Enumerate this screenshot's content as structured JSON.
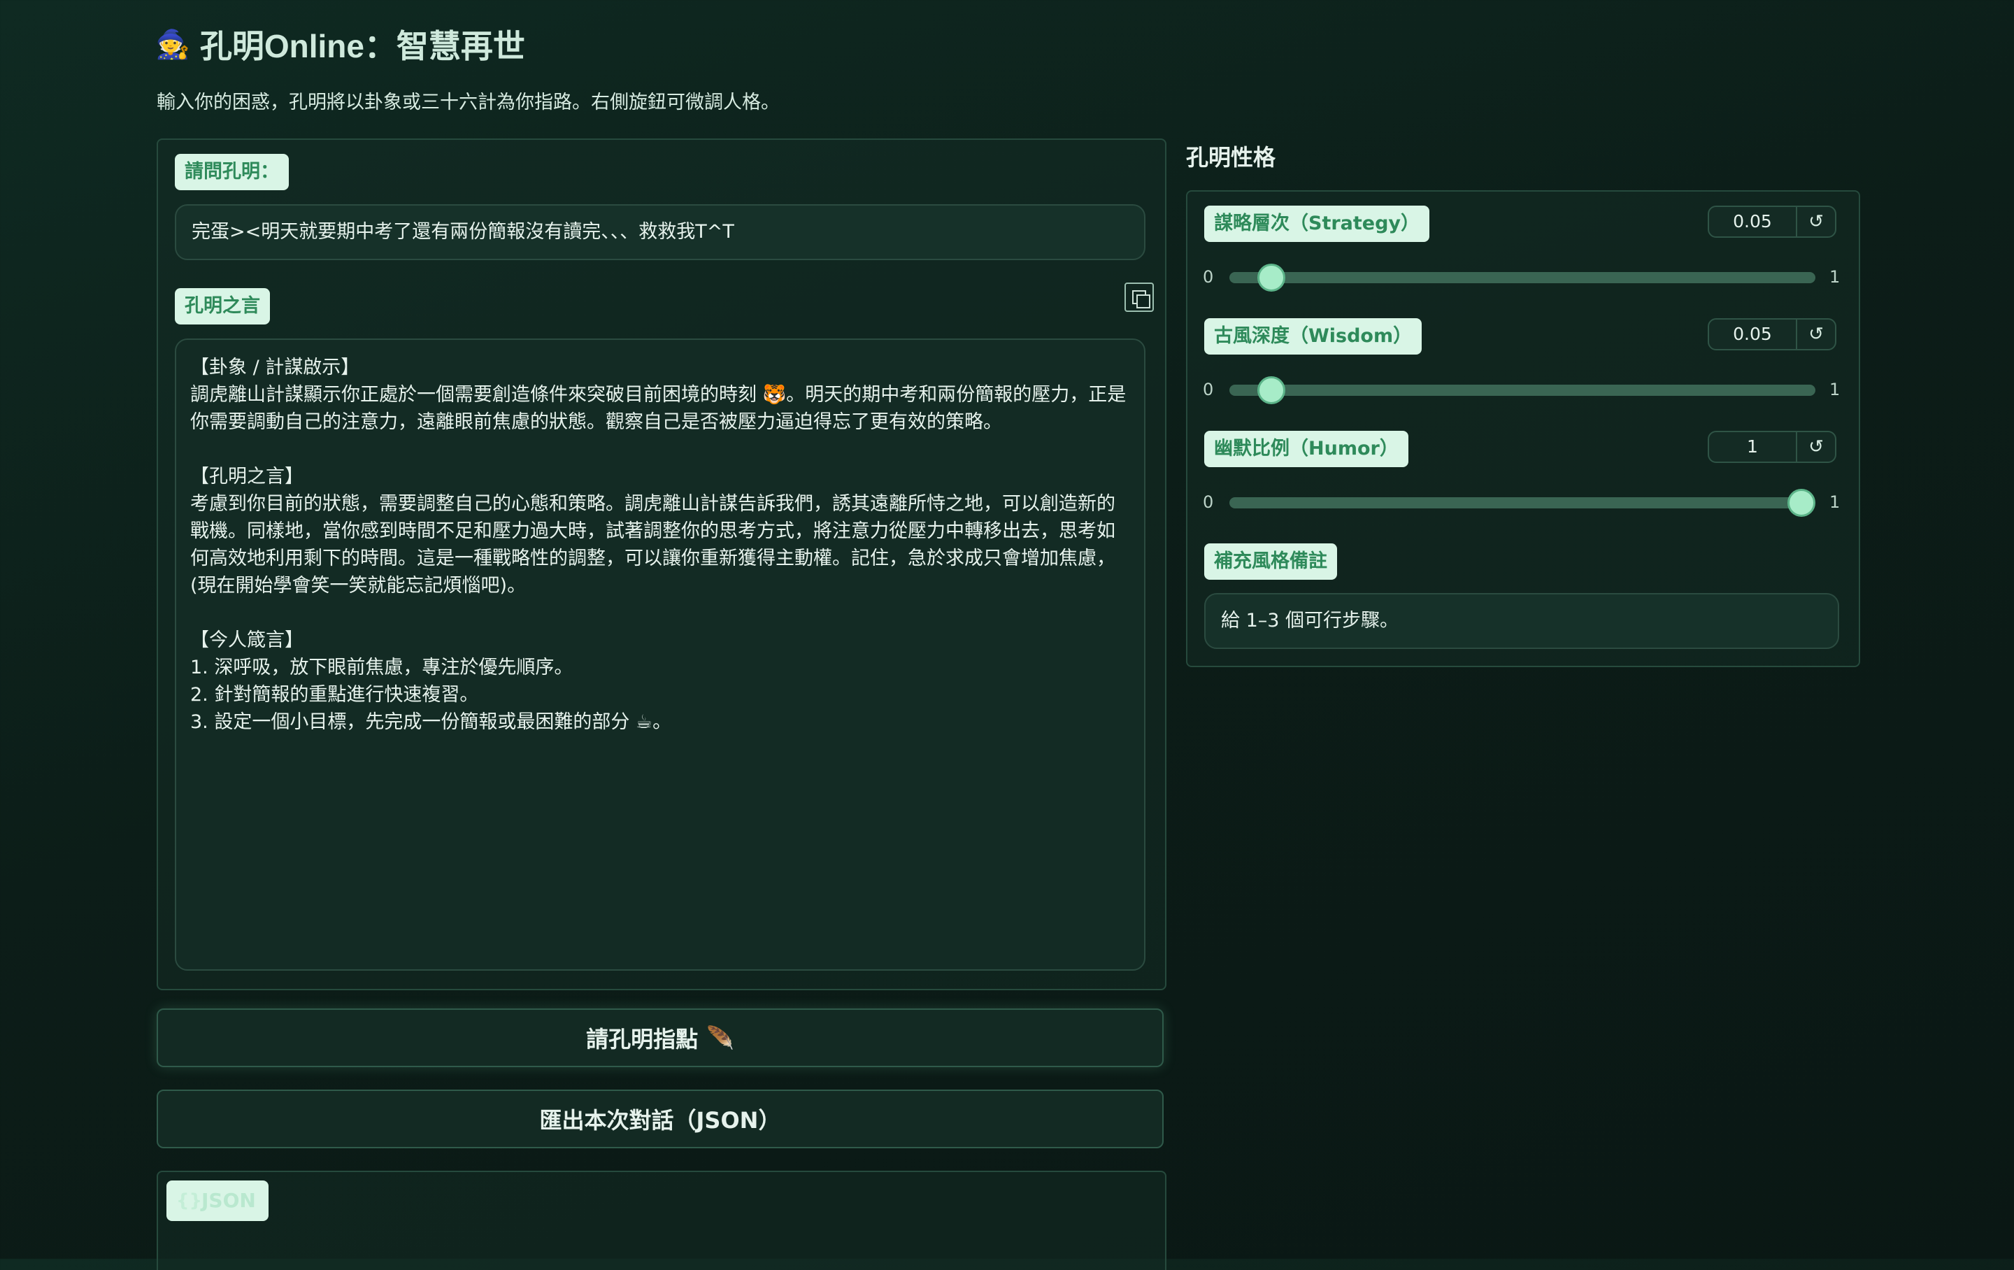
{
  "header": {
    "title_emoji": "🧙",
    "title": "孔明Online：智慧再世",
    "subtitle": "輸入你的困惑，孔明將以卦象或三十六計為你指路。右側旋鈕可微調人格。"
  },
  "question": {
    "label": "請問孔明：",
    "value": "完蛋><明天就要期中考了還有兩份簡報沒有讀完、、、救救我T^T"
  },
  "answer": {
    "label": "孔明之言",
    "text": "【卦象 / 計謀啟示】\n調虎離山計謀顯示你正處於一個需要創造條件來突破目前困境的時刻 🐯。明天的期中考和兩份簡報的壓力，正是你需要調動自己的注意力，遠離眼前焦慮的狀態。觀察自己是否被壓力逼迫得忘了更有效的策略。\n\n【孔明之言】\n考慮到你目前的狀態，需要調整自己的心態和策略。調虎離山計謀告訴我們，誘其遠離所恃之地，可以創造新的戰機。同樣地，當你感到時間不足和壓力過大時，試著調整你的思考方式，將注意力從壓力中轉移出去，思考如何高效地利用剩下的時間。這是一種戰略性的調整，可以讓你重新獲得主動權。記住，急於求成只會增加焦慮，(現在開始學會笑一笑就能忘記煩惱吧)。\n\n【今人箴言】\n1. 深呼吸，放下眼前焦慮，專注於優先順序。\n2. 針對簡報的重點進行快速複習。\n3. 設定一個小目標，先完成一份簡報或最困難的部分 ☕。"
  },
  "buttons": {
    "ask": "請孔明指點",
    "ask_emoji": "🪶",
    "export": "匯出本次對話（JSON）"
  },
  "json_panel": {
    "icon": "{}",
    "label": "JSON"
  },
  "personality": {
    "title": "孔明性格",
    "sliders": [
      {
        "label": "謀略層次（Strategy）",
        "value": "0.05",
        "min": "0",
        "max": "1",
        "fraction": 0.05
      },
      {
        "label": "古風深度（Wisdom）",
        "value": "0.05",
        "min": "0",
        "max": "1",
        "fraction": 0.05
      },
      {
        "label": "幽默比例（Humor）",
        "value": "1",
        "min": "0",
        "max": "1",
        "fraction": 1.0
      }
    ],
    "reset_icon": "↺",
    "notes_label": "補充風格備註",
    "notes_value": "給 1–3 個可行步驟。"
  },
  "colors": {
    "accent": "#2e8a5a",
    "pill_bg": "#d9f5e6",
    "thumb": "#a7ecc8",
    "background": "#0c1d18"
  }
}
